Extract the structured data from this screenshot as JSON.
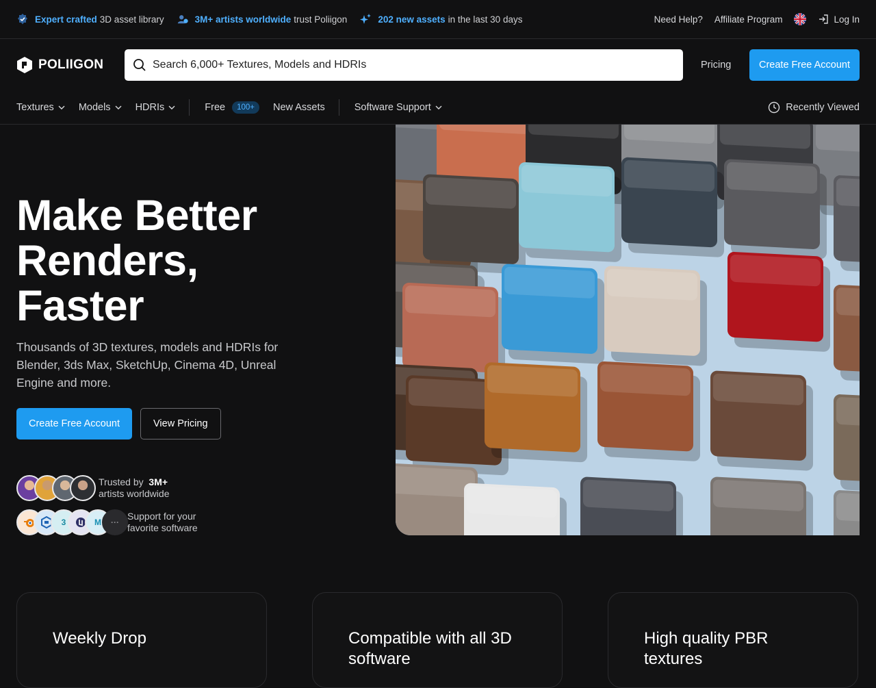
{
  "topbar": {
    "items": [
      {
        "highlight": "Expert crafted",
        "text": "3D asset library",
        "icon": "verified-badge-icon"
      },
      {
        "highlight": "3M+ artists worldwide",
        "text": "trust Poliigon",
        "icon": "users-icon"
      },
      {
        "highlight": "202 new assets",
        "text": "in the last 30 days",
        "icon": "sparkle-icon"
      }
    ],
    "help": "Need Help?",
    "affiliate": "Affiliate Program",
    "login": "Log In"
  },
  "header": {
    "logo": "POLIIGON",
    "search_placeholder": "Search 6,000+ Textures, Models and HDRIs",
    "pricing": "Pricing",
    "cta": "Create Free Account"
  },
  "nav": {
    "textures": "Textures",
    "models": "Models",
    "hdris": "HDRIs",
    "free": "Free",
    "free_badge": "100+",
    "new_assets": "New Assets",
    "software_support": "Software Support",
    "recently_viewed": "Recently Viewed"
  },
  "hero": {
    "title_l1": "Make Better",
    "title_l2": "Renders,",
    "title_l3": "Faster",
    "subtitle": "Thousands of 3D textures, models and HDRIs for Blender, 3ds Max, SketchUp, Cinema 4D, Unreal Engine and more.",
    "cta_primary": "Create Free Account",
    "cta_secondary": "View Pricing",
    "trusted_prefix": "Trusted by",
    "trusted_count": "3M+",
    "trusted_suffix": "artists worldwide",
    "support_l1": "Support for your",
    "support_l2": "favorite software",
    "software_icons": [
      "blender-icon",
      "sketchup-icon",
      "3dsmax-icon",
      "unreal-icon",
      "maya-icon",
      "more-icon"
    ]
  },
  "cards": [
    {
      "title": "Weekly Drop"
    },
    {
      "title": "Compatible with all 3D software"
    },
    {
      "title": "High quality PBR textures"
    }
  ],
  "colors": {
    "accent": "#1e9bf0",
    "link": "#4fb0ff",
    "background": "#111112"
  }
}
